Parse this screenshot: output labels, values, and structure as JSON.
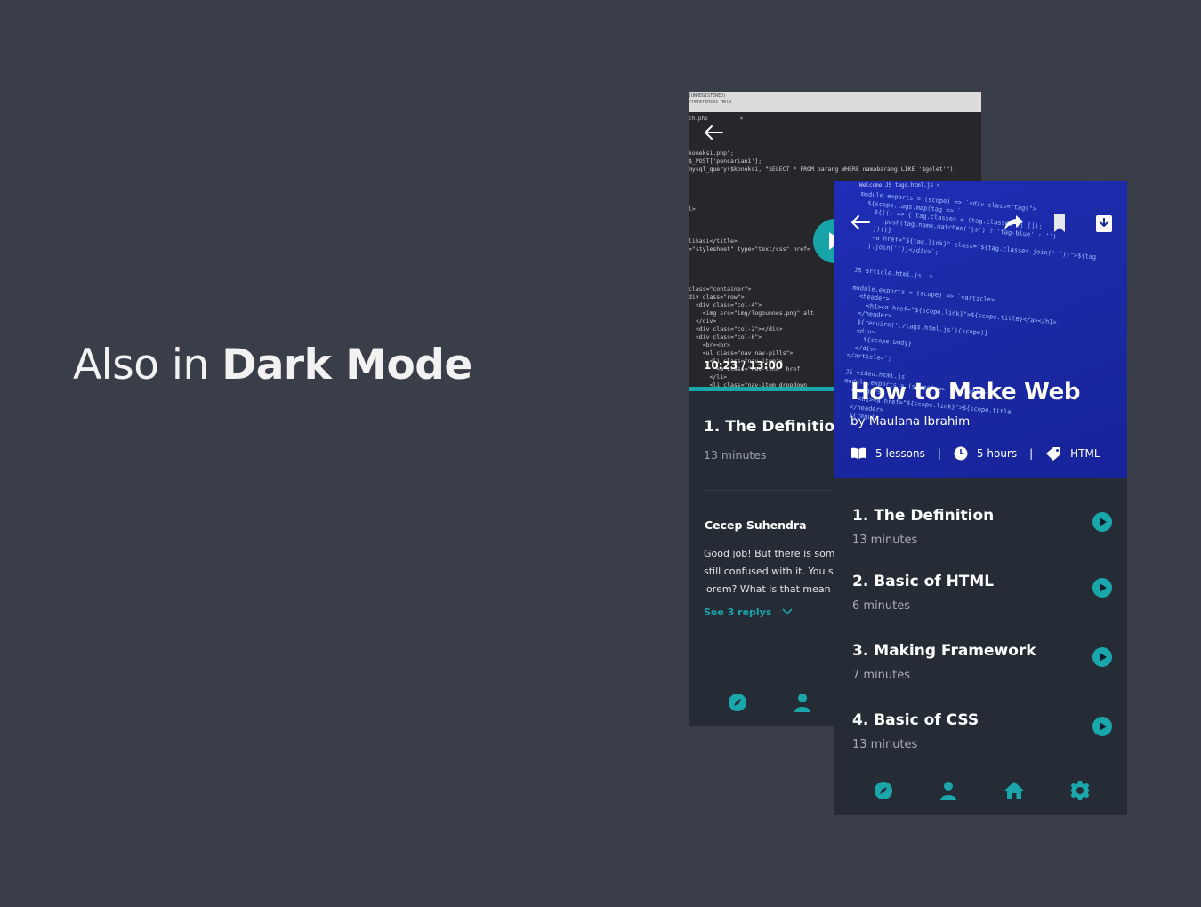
{
  "headline": {
    "light": "Also in ",
    "bold": "Dark Mode"
  },
  "player_screen": {
    "ide_menu": [
      "(UNREGISTERED)",
      "Preferences   Help"
    ],
    "ide_tab": {
      "file": "ch.php",
      "close": "×"
    },
    "code_lines": [
      "koneksi.php\";",
      "$_POST['pencarian1'];",
      "mysql_query($koneksi, \"SELECT * FROM barang WHERE namabarang LIKE '$golet'\");",
      "",
      "",
      "",
      "",
      "l>",
      "",
      "",
      "",
      "likasi</title>",
      "=\"stylesheet\" type=\"text/css\" href=",
      "",
      "",
      "",
      "",
      "class=\"container\">",
      "div class=\"row\">",
      "  <div class=\"col-4\">",
      "    <img src=\"img/logounnes.png\" alt",
      "  </div>",
      "  <div class=\"col-2\"></div>",
      "  <div class=\"col-6\">",
      "    <br><br>",
      "    <ul class=\"nav nav-pills\">",
      "      <li class=\"nav-item\">",
      "        <a class=\"nav-link\" href",
      "      </li>",
      "      <li class=\"nav-item dropdown"
    ],
    "time_current": "10:23",
    "time_total": "13:00",
    "progress": 0.79,
    "lesson": {
      "title": "1. The Definition",
      "duration": "13 minutes"
    },
    "comment": {
      "author": "Cecep Suhendra",
      "lines": [
        "Good job! But there is som",
        "still confused with it. You s",
        "lorem? What is that mean"
      ],
      "replies_label": "See 3 replys"
    },
    "nav_icons": [
      "compass-icon",
      "user-icon"
    ]
  },
  "course_screen": {
    "editor_tabs": "Welcome        JS tags.html.js  ×",
    "code_lines": [
      "module.exports = (scope) => `<div class=\"tags\">",
      "  ${scope.tags.map(tag => `",
      "    ${(() => { tag.classes = (tag.classes || []);",
      "      .push(tag.name.matches('js') ? 'tag-blue' : '')",
      "    })()}",
      "    <a href=\"${tag.link}\" class=\"${tag.classes.join(' ')}\">${tag",
      "  `).join('')}</div>`;",
      "",
      "",
      "JS article.html.js  ×",
      "",
      "module.exports = (scope) => `<article>",
      "  <header>",
      "    <h1><a href=\"${scope.link}\">${scope.title}</a></h1>",
      "  </header>",
      "  ${require('./tags.html.js')(scope)}",
      "  <div>",
      "    ${scope.body}",
      "  </div>",
      "</article>`;",
      "",
      "JS video.html.js",
      "module.exports = (scope) => `<article>",
      "  <header>",
      "    <h1><a href=\"${scope.link}\">${scope.title",
      "  </header>",
      "  ${requir"
    ],
    "title": "How to Make Web",
    "author": "by Maulana Ibrahim",
    "meta": {
      "lessons": "5 lessons",
      "hours": "5 hours",
      "tag": "HTML",
      "separator": "|"
    },
    "lessons": [
      {
        "title": "1. The Definition",
        "duration": "13 minutes"
      },
      {
        "title": "2. Basic of HTML",
        "duration": "6 minutes"
      },
      {
        "title": "3. Making Framework",
        "duration": "7 minutes"
      },
      {
        "title": "4. Basic of CSS",
        "duration": "13 minutes"
      }
    ],
    "nav_icons": [
      "compass-icon",
      "user-icon",
      "home-icon",
      "gear-icon"
    ]
  },
  "colors": {
    "background": "#3a3e48",
    "panel": "#262c36",
    "accent": "#1aa7ab",
    "hero": "#1f2db8"
  }
}
